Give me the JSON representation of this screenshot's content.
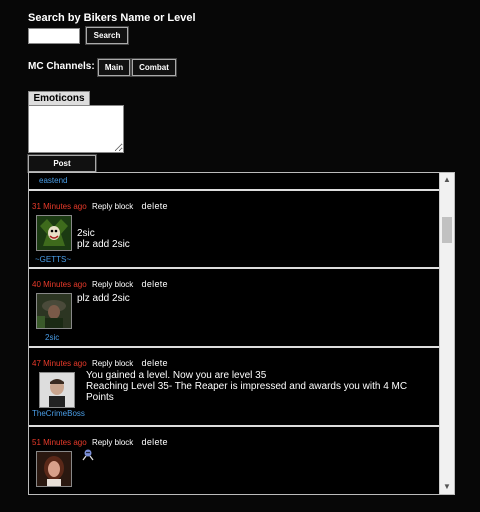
{
  "search": {
    "title": "Search by Bikers Name or Level",
    "button": "Search",
    "value": ""
  },
  "channels": {
    "label": "MC Channels:",
    "main": "Main",
    "combat": "Combat"
  },
  "compose": {
    "emoticons": "Emoticons",
    "post": "Post",
    "value": ""
  },
  "feed": {
    "top_name": "eastend",
    "posts": [
      {
        "time": "31 Minutes ago",
        "actions": "Reply block",
        "delete": "delete",
        "user": "~GETTS~",
        "lines": [
          "2sic",
          "plz add 2sic"
        ]
      },
      {
        "time": "40 Minutes ago",
        "actions": "Reply block",
        "delete": "delete",
        "user": "2sic",
        "lines": [
          "plz add 2sic"
        ]
      },
      {
        "time": "47 Minutes ago",
        "actions": "Reply block",
        "delete": "delete",
        "user": "TheCrimeBoss",
        "lines": [
          "You gained a level. Now you are level 35",
          "Reaching Level 35- The Reaper is impressed and awards you with 4 MC",
          "Points"
        ]
      },
      {
        "time": "51 Minutes ago",
        "actions": "Reply block",
        "delete": "delete",
        "user": "",
        "lines": []
      }
    ]
  },
  "colors": {
    "time": "#e83a2a",
    "username": "#4a9ee8",
    "background": "#070707"
  }
}
